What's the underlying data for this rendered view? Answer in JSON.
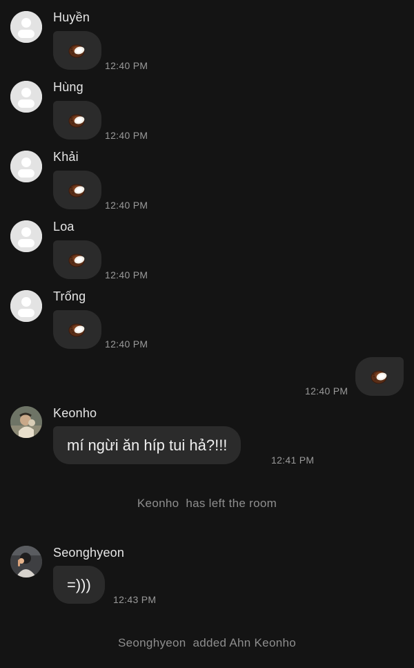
{
  "messages": [
    {
      "sender": "Huyền",
      "emoji": "coconut",
      "time": "12:40 PM"
    },
    {
      "sender": "Hùng",
      "emoji": "coconut",
      "time": "12:40 PM"
    },
    {
      "sender": "Khải",
      "emoji": "coconut",
      "time": "12:40 PM"
    },
    {
      "sender": "Loa",
      "emoji": "coconut",
      "time": "12:40 PM"
    },
    {
      "sender": "Trống",
      "emoji": "coconut",
      "time": "12:40 PM"
    }
  ],
  "outgoing": {
    "emoji": "coconut",
    "time": "12:40 PM"
  },
  "keonho": {
    "sender": "Keonho",
    "text": "mí ngừi ăn híp tui hả?!!!",
    "time": "12:41 PM"
  },
  "system1": {
    "name": "Keonho",
    "text": "has left the room"
  },
  "seonghyeon": {
    "sender": "Seonghyeon",
    "text": "=)))",
    "time": "12:43 PM"
  },
  "system2": {
    "name": "Seonghyeon",
    "text": "added Ahn Keonho"
  },
  "colors": {
    "background": "#141414",
    "bubble": "#2b2b2b",
    "timestamp": "#9a9a9a",
    "system_text": "#8e8e8e"
  }
}
